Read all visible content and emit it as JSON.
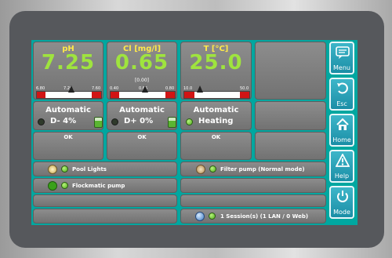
{
  "sensors": [
    {
      "name": "pH",
      "value": "7.25",
      "sub": "",
      "scale_min": "6.80",
      "scale_mid": "7.20",
      "scale_max": "7.60",
      "mode": "Automatic",
      "state": "D- 4%",
      "status": "OK"
    },
    {
      "name": "Cl [mg/l]",
      "value": "0.65",
      "sub": "[0.00]",
      "scale_min": "0.40",
      "scale_mid": "0.65",
      "scale_max": "0.80",
      "mode": "Automatic",
      "state": "D+ 0%",
      "status": "OK"
    },
    {
      "name": "T [°C]",
      "value": "25.0",
      "sub": "",
      "scale_min": "10.0",
      "scale_mid": "",
      "scale_max": "50.0",
      "mode": "Automatic",
      "state": "Heating",
      "status": "OK"
    }
  ],
  "relays": {
    "pool_lights": "Pool Lights",
    "flockmatic": "Flockmatic pump",
    "filter_pump": "Filter pump (Normal mode)",
    "sessions": "1 Session(s) (1 LAN / 0 Web)"
  },
  "sidebar": {
    "menu": "Menu",
    "esc": "Esc",
    "home": "Home",
    "help": "Help",
    "mode": "Mode"
  },
  "colors": {
    "screen": "#00a7a0",
    "value": "#9fe43e",
    "label": "#ffe94a",
    "button": "#2aa3b8"
  }
}
